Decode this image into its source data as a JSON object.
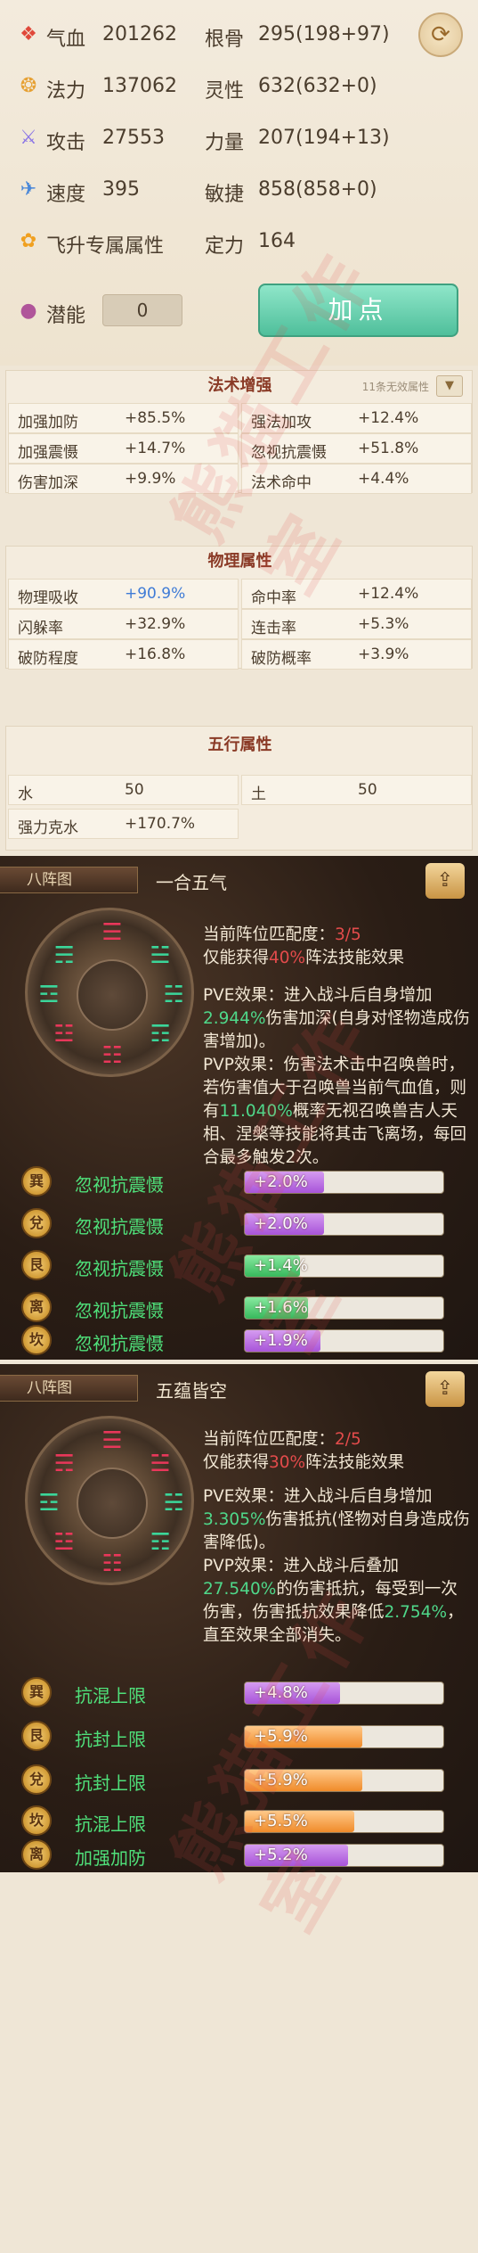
{
  "stats": {
    "hp": {
      "label": "气血",
      "value": "201262",
      "icon": "blood-drop-icon"
    },
    "bone": {
      "label": "根骨",
      "value": "295",
      "detail": "(198+97)"
    },
    "mana": {
      "label": "法力",
      "value": "137062",
      "icon": "swirl-icon"
    },
    "spirit": {
      "label": "灵性",
      "value": "632",
      "detail": "(632+0)"
    },
    "attack": {
      "label": "攻击",
      "value": "27553",
      "icon": "sword-icon"
    },
    "strength": {
      "label": "力量",
      "value": "207",
      "detail": "(194+13)"
    },
    "speed": {
      "label": "速度",
      "value": "395",
      "icon": "boot-icon"
    },
    "agility": {
      "label": "敏捷",
      "value": "858",
      "detail": "(858+0)"
    },
    "ascend": {
      "label": "飞升专属属性",
      "icon": "lotus-icon"
    },
    "focus": {
      "label": "定力",
      "value": "164"
    },
    "potential": {
      "label": "潜能",
      "value": "0",
      "icon": "orb-icon"
    },
    "add_point_button": "加点",
    "refresh_icon": "refresh-icon"
  },
  "magic_section": {
    "title": "法术增强",
    "hint": "11条无效属性",
    "cells": [
      {
        "k": "加强加防",
        "v": "+85.5%"
      },
      {
        "k": "强法加攻",
        "v": "+12.4%"
      },
      {
        "k": "加强震慑",
        "v": "+14.7%"
      },
      {
        "k": "忽视抗震慑",
        "v": "+51.8%"
      },
      {
        "k": "伤害加深",
        "v": "+9.9%"
      },
      {
        "k": "法术命中",
        "v": "+4.4%"
      }
    ]
  },
  "physical_section": {
    "title": "物理属性",
    "cells": [
      {
        "k": "物理吸收",
        "v": "+90.9%"
      },
      {
        "k": "命中率",
        "v": "+12.4%"
      },
      {
        "k": "闪躲率",
        "v": "+32.9%"
      },
      {
        "k": "连击率",
        "v": "+5.3%"
      },
      {
        "k": "破防程度",
        "v": "+16.8%"
      },
      {
        "k": "破防概率",
        "v": "+3.9%"
      }
    ]
  },
  "element_section": {
    "title": "五行属性",
    "cells": [
      {
        "k": "水",
        "v": "50"
      },
      {
        "k": "土",
        "v": "50"
      },
      {
        "k": "强力克水",
        "v": "+170.7%"
      }
    ]
  },
  "formation1": {
    "tab": "八阵图",
    "name": "一合五气",
    "match_label": "当前阵位匹配度：",
    "match_value": "3/5",
    "effect_pre": "仅能获得",
    "effect_pct": "40%",
    "effect_post": "阵法技能效果",
    "pve_1": "PVE效果：进入战斗后自身增加",
    "pve_val": "2.944%",
    "pve_2": "伤害加深(自身对怪物造成伤害增加)。",
    "pvp_1": "PVP效果：伤害法术击中召唤兽时，若伤害值大于召唤兽当前气血值，则有",
    "pvp_val": "11.040%",
    "pvp_2": "概率无视召唤兽吉人天相、涅槃等技能将其击飞离场，每回合最多触发2次。",
    "rows": [
      {
        "trigram": "巽",
        "label": "忽视抗震慑",
        "value": "+2.0%",
        "fill": 0.4,
        "color": "purple"
      },
      {
        "trigram": "兌",
        "label": "忽视抗震慑",
        "value": "+2.0%",
        "fill": 0.4,
        "color": "purple"
      },
      {
        "trigram": "艮",
        "label": "忽视抗震慑",
        "value": "+1.4%",
        "fill": 0.28,
        "color": "green"
      },
      {
        "trigram": "离",
        "label": "忽视抗震慑",
        "value": "+1.6%",
        "fill": 0.32,
        "color": "green"
      },
      {
        "trigram": "坎",
        "label": "忽视抗震慑",
        "value": "+1.9%",
        "fill": 0.38,
        "color": "purple"
      }
    ]
  },
  "formation2": {
    "tab": "八阵图",
    "name": "五蕴皆空",
    "match_label": "当前阵位匹配度：",
    "match_value": "2/5",
    "effect_pre": "仅能获得",
    "effect_pct": "30%",
    "effect_post": "阵法技能效果",
    "pve_1": "PVE效果：进入战斗后自身增加",
    "pve_val": "3.305%",
    "pve_2": "伤害抵抗(怪物对自身造成伤害降低)。",
    "pvp_1": "PVP效果：进入战斗后叠加",
    "pvp_val": "27.540%",
    "pvp_2": "的伤害抵抗，每受到一次伤害，伤害抵抗效果降低",
    "pvp_val2": "2.754%",
    "pvp_3": "，直至效果全部消失。",
    "rows": [
      {
        "trigram": "巽",
        "label": "抗混上限",
        "value": "+4.8%",
        "fill": 0.48,
        "color": "purple"
      },
      {
        "trigram": "艮",
        "label": "抗封上限",
        "value": "+5.9%",
        "fill": 0.59,
        "color": "orange"
      },
      {
        "trigram": "兌",
        "label": "抗封上限",
        "value": "+5.9%",
        "fill": 0.59,
        "color": "orange"
      },
      {
        "trigram": "坎",
        "label": "抗混上限",
        "value": "+5.5%",
        "fill": 0.55,
        "color": "orange"
      },
      {
        "trigram": "离",
        "label": "加强加防",
        "value": "+5.2%",
        "fill": 0.52,
        "color": "purple"
      }
    ]
  },
  "share_icon": "share-icon"
}
